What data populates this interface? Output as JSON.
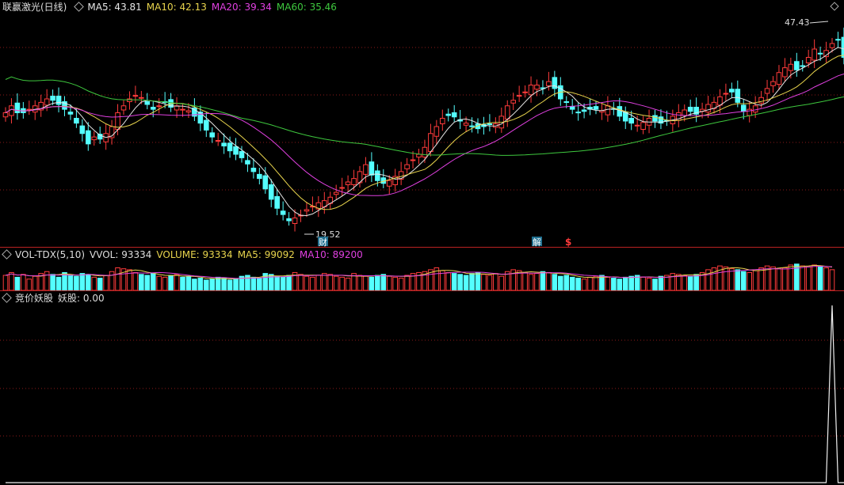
{
  "title": "联赢激光(日线)",
  "price_header": [
    {
      "label": "MA5: 43.81",
      "color": "#e6e6e6"
    },
    {
      "label": "MA10: 42.13",
      "color": "#e8d44d"
    },
    {
      "label": "MA20: 39.34",
      "color": "#e040e0"
    },
    {
      "label": "MA60: 35.46",
      "color": "#3ec83e"
    }
  ],
  "vol_header": [
    {
      "label": "VOL-TDX(5,10)",
      "color": "#dddddd"
    },
    {
      "label": "VVOL: 93334",
      "color": "#dddddd"
    },
    {
      "label": "VOLUME: 93334",
      "color": "#e8d44d"
    },
    {
      "label": "MA5: 99092",
      "color": "#e8d44d"
    },
    {
      "label": "MA10: 89200",
      "color": "#e040e0"
    }
  ],
  "ind_header": [
    {
      "label": "竞价妖股",
      "color": "#dddddd"
    },
    {
      "label": "妖股: 0.00",
      "color": "#dddddd"
    }
  ],
  "annotations": {
    "high_label": "47.43",
    "low_label": "19.52",
    "event_cai": "财",
    "event_jie": "解",
    "event_dollar": "$"
  },
  "colors": {
    "up": "#ff3b3b",
    "down": "#54ffff",
    "bg": "#000000",
    "ma5": "#e6e6e6",
    "ma10": "#e8d44d",
    "ma20": "#e040e0",
    "ma60": "#3ec83e",
    "grid": "#8b1a1a"
  },
  "chart_data": [
    {
      "type": "candlestick",
      "title": "联赢激光(日线)",
      "price_range": [
        18,
        50
      ],
      "high": 47.43,
      "low": 19.52,
      "ma_last": {
        "MA5": 43.81,
        "MA10": 42.13,
        "MA20": 39.34,
        "MA60": 35.46
      },
      "closes": [
        36,
        37,
        36,
        36,
        36.5,
        37,
        37.5,
        38,
        37.8,
        37.2,
        36.5,
        35.8,
        34.5,
        33,
        31.5,
        32.5,
        32.2,
        33,
        34,
        36,
        37,
        38,
        38.5,
        38.2,
        37.2,
        36.5,
        37,
        37.5,
        36.8,
        37,
        36.5,
        36.3,
        35.5,
        34.5,
        33.5,
        32.5,
        32,
        31.2,
        30.5,
        30,
        29.5,
        28.6,
        27.5,
        26.5,
        25,
        23.5,
        22.2,
        21.3,
        20.4,
        20.8,
        21.2,
        22,
        22.5,
        23,
        23.3,
        23.8,
        24.5,
        25.2,
        26,
        26.5,
        27.5,
        28.5,
        27,
        26.2,
        25.8,
        26.2,
        26.8,
        27.5,
        28.5,
        29.2,
        30,
        31,
        33,
        34,
        35.2,
        35.6,
        35.4,
        34.8,
        34.5,
        34,
        33.7,
        34,
        34.3,
        34.4,
        35.5,
        37,
        37.8,
        38.5,
        39,
        40,
        40,
        39.5,
        40.5,
        39.5,
        38,
        37.5,
        36.5,
        36,
        36.2,
        36.5,
        36.5,
        36.3,
        37,
        36.5,
        35.5,
        34.8,
        34.5,
        34.2,
        34.6,
        35.2,
        34.8,
        34.5,
        34.8,
        35.5,
        36,
        36.4,
        36.2,
        35.8,
        36.5,
        37.2,
        37.5,
        38.3,
        38.8,
        39,
        37.5,
        36.2,
        36.5,
        37,
        38.2,
        39.5,
        40.5,
        41.8,
        42.5,
        43,
        42.2,
        42.8,
        44,
        45.2,
        44.5,
        45,
        46,
        46.5,
        44,
        42
      ],
      "volume": {
        "vvol_last": 93334,
        "ma5_last": 99092,
        "ma10_last": 89200,
        "values": [
          80,
          95,
          70,
          85,
          60,
          75,
          90,
          100,
          85,
          70,
          95,
          80,
          75,
          90,
          85,
          70,
          65,
          80,
          100,
          120,
          115,
          110,
          95,
          85,
          80,
          90,
          75,
          70,
          80,
          85,
          70,
          75,
          60,
          65,
          55,
          60,
          70,
          65,
          55,
          60,
          75,
          80,
          70,
          65,
          90,
          85,
          75,
          70,
          80,
          95,
          85,
          75,
          70,
          80,
          90,
          85,
          75,
          70,
          65,
          90,
          80,
          75,
          70,
          80,
          85,
          75,
          70,
          65,
          80,
          90,
          95,
          100,
          110,
          120,
          105,
          95,
          90,
          85,
          80,
          90,
          95,
          85,
          80,
          90,
          75,
          100,
          110,
          105,
          95,
          85,
          90,
          100,
          95,
          85,
          75,
          80,
          70,
          65,
          60,
          70,
          75,
          80,
          70,
          65,
          60,
          70,
          75,
          80,
          70,
          65,
          60,
          75,
          80,
          90,
          85,
          80,
          75,
          85,
          95,
          110,
          120,
          130,
          125,
          115,
          110,
          100,
          95,
          105,
          120,
          130,
          125,
          115,
          120,
          135,
          140,
          130,
          125,
          135,
          130,
          120,
          110
        ]
      },
      "indicator": {
        "name": "妖股",
        "last": 0.0,
        "spike_index": 140,
        "spike_value": 1.0
      }
    }
  ]
}
